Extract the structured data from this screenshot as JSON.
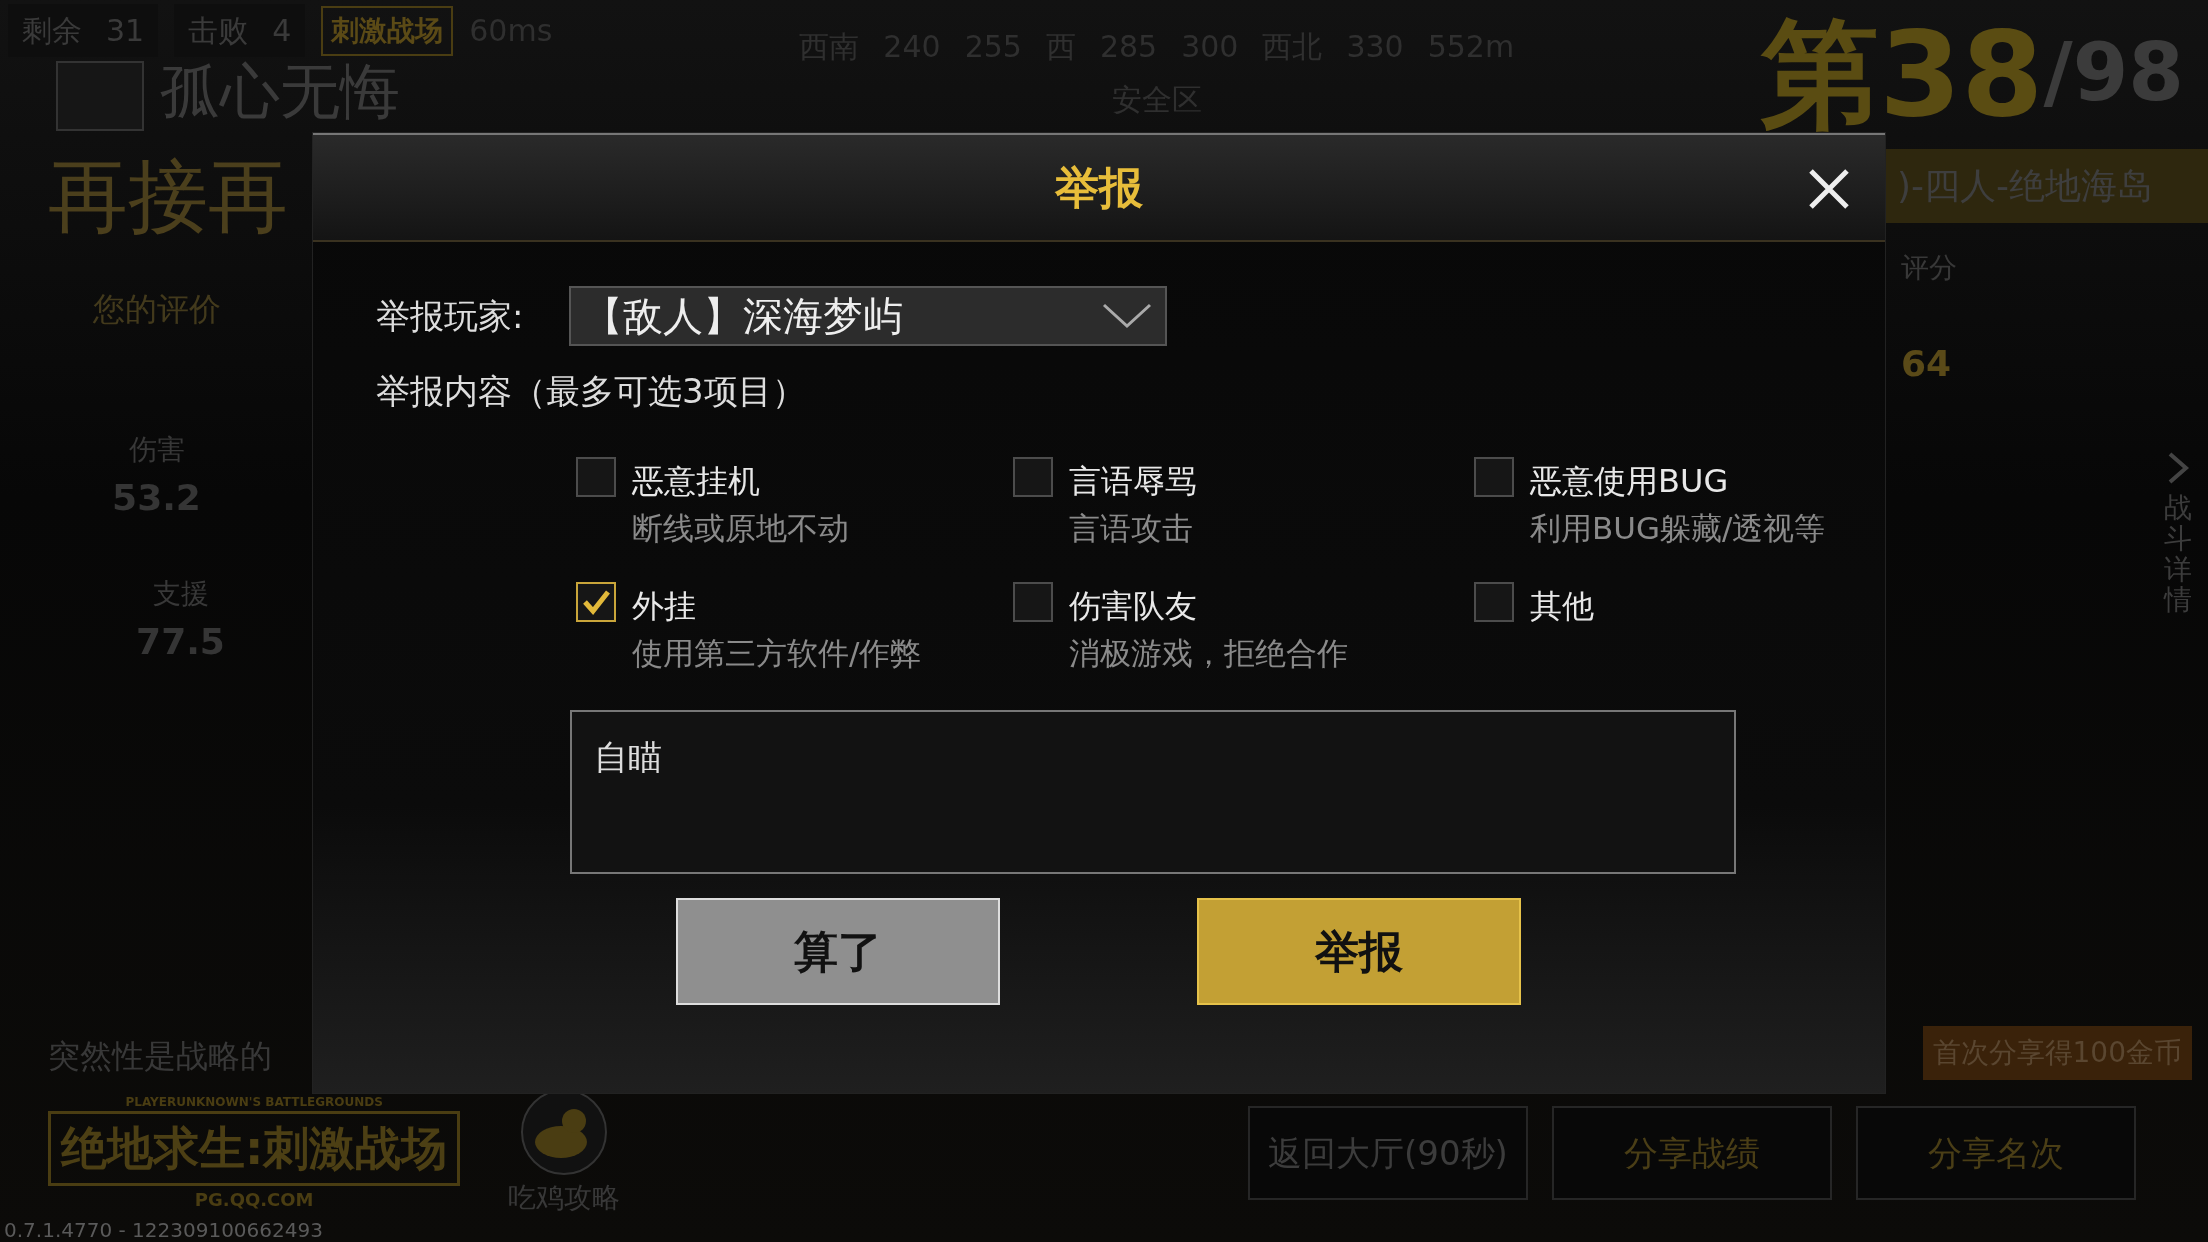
{
  "hud": {
    "remaining_label": "剩余",
    "remaining": "31",
    "kills_label": "击败",
    "kills": "4",
    "mode_badge": "刺激战场",
    "ping": "60ms",
    "compass": [
      "西南",
      "240",
      "255",
      "西",
      "285",
      "300",
      "西北",
      "330"
    ],
    "distance": "552m",
    "zone_label": "安全区",
    "player_name": "孤心无悔",
    "banner": "再接再",
    "rank": "第38",
    "total": "/98"
  },
  "summary": {
    "rating_title": "您的评价",
    "stats": [
      {
        "label": "伤害",
        "value": "53.2"
      },
      {
        "label": "支援",
        "value": "77.5"
      }
    ],
    "tip": "突然性是战略的",
    "mode_banner": ")-四人-绝地海岛",
    "score_label": "评分",
    "score_value": "64",
    "details_link": "战斗详情"
  },
  "footer": {
    "logo_caption": "PLAYERUNKNOWN'S BATTLEGROUNDS",
    "logo_title": "绝地求生:刺激战场",
    "logo_url": "PG.QQ.COM",
    "guide": "吃鸡攻略",
    "version": "0.7.1.4770 - 122309100662493",
    "share_tip": "首次分享得100金币",
    "buttons": [
      "返回大厅(90秒)",
      "分享战绩",
      "分享名次"
    ]
  },
  "dialog": {
    "title": "举报",
    "player_label": "举报玩家:",
    "player": "【敌人】深海梦屿",
    "content_label": "举报内容（最多可选3项目）",
    "reasons": [
      {
        "label": "恶意挂机",
        "hint": "断线或原地不动",
        "checked": false
      },
      {
        "label": "言语辱骂",
        "hint": "言语攻击",
        "checked": false
      },
      {
        "label": "恶意使用BUG",
        "hint": "利用BUG躲藏/透视等",
        "checked": false
      },
      {
        "label": "外挂",
        "hint": "使用第三方软件/作弊",
        "checked": true
      },
      {
        "label": "伤害队友",
        "hint": "消极游戏，拒绝合作",
        "checked": false
      },
      {
        "label": "其他",
        "checked": false
      }
    ],
    "description": "自瞄",
    "buttons": [
      {
        "label": "算了",
        "kind": "cancel"
      },
      {
        "label": "举报",
        "kind": "confirm"
      }
    ]
  }
}
